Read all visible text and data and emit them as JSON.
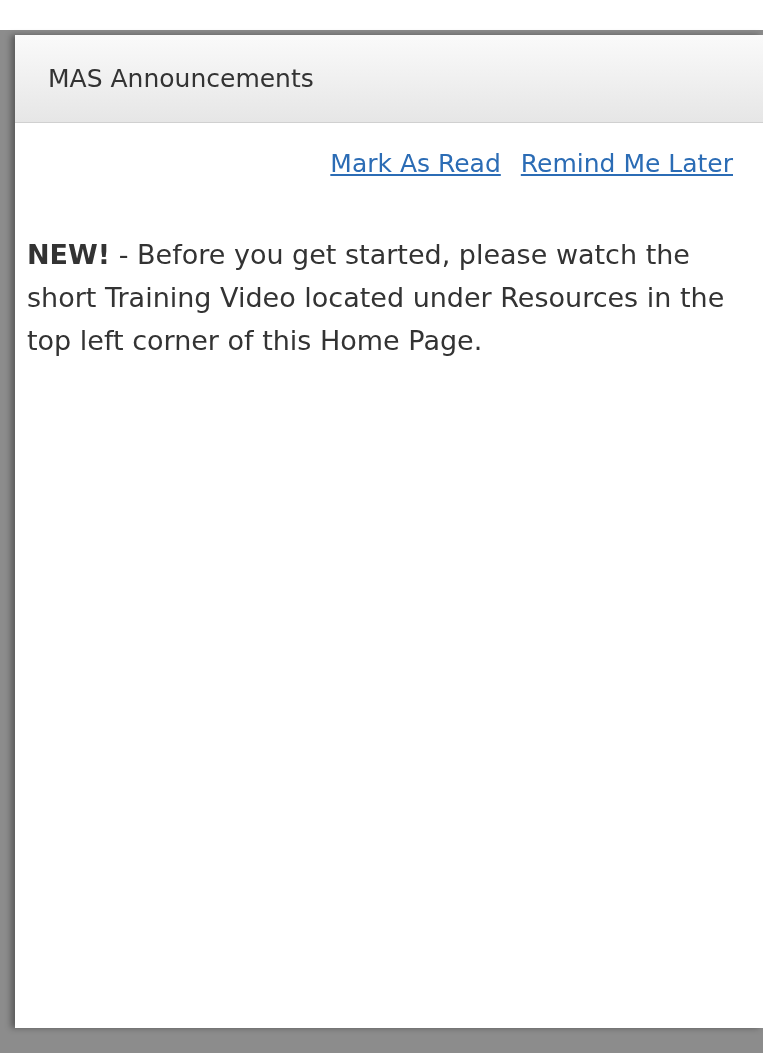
{
  "dialog": {
    "title": "MAS Announcements",
    "links": [
      {
        "label": "Mark As Read"
      },
      {
        "label": "Remind Me Later"
      }
    ],
    "message": "**NEW!** - Before you get started, please watch the short Training Video located under Resources in the top left corner of this Home Page."
  }
}
